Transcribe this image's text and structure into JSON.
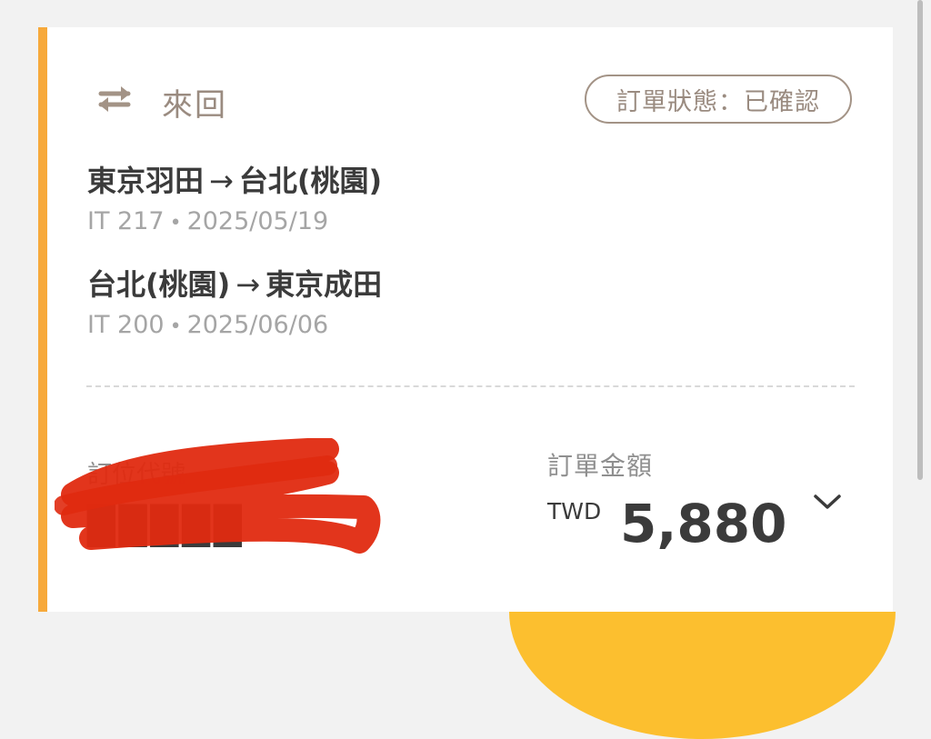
{
  "trip": {
    "type_label": "來回",
    "status": "訂單狀態：已確認"
  },
  "segments": [
    {
      "from": "東京羽田",
      "arrow": "→",
      "to": "台北(桃園)",
      "flight": "IT 217",
      "sep": "•",
      "date": "2025/05/19"
    },
    {
      "from": "台北(桃園)",
      "arrow": "→",
      "to": "東京成田",
      "flight": "IT 200",
      "sep": "•",
      "date": "2025/06/06"
    }
  ],
  "booking": {
    "pnr_label": "訂位代號",
    "pnr_value": "█████"
  },
  "amount": {
    "label": "訂單金額",
    "currency": "TWD",
    "value": "5,880"
  },
  "colors": {
    "accent": "#f7a93b",
    "brand_yellow": "#fcbf2f",
    "badge_border": "#a39386",
    "redaction": "#e02a10"
  },
  "icons": {
    "trip": "round-trip-arrows-icon",
    "expand": "chevron-down-icon"
  }
}
